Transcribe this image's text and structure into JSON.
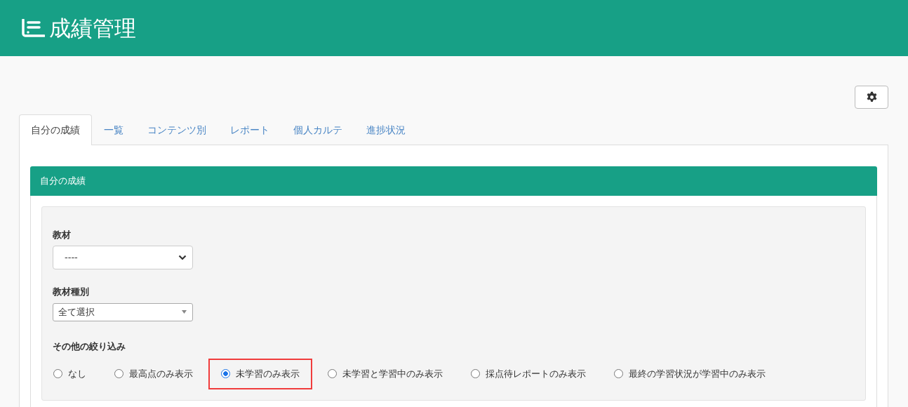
{
  "header": {
    "title": "成績管理"
  },
  "tabs": [
    {
      "label": "自分の成績",
      "selected": true
    },
    {
      "label": "一覧",
      "selected": false
    },
    {
      "label": "コンテンツ別",
      "selected": false
    },
    {
      "label": "レポート",
      "selected": false
    },
    {
      "label": "個人カルテ",
      "selected": false
    },
    {
      "label": "進捗状況",
      "selected": false
    }
  ],
  "panel": {
    "title": "自分の成績",
    "fields": [
      {
        "kind": "select",
        "label": "教材",
        "value": "----"
      },
      {
        "kind": "combo",
        "label": "教材種別",
        "value": "全て選択"
      }
    ],
    "filter": {
      "label": "その他の絞り込み",
      "options": [
        {
          "label": "なし",
          "selected": false,
          "highlighted": false
        },
        {
          "label": "最高点のみ表示",
          "selected": false,
          "highlighted": false
        },
        {
          "label": "未学習のみ表示",
          "selected": true,
          "highlighted": true
        },
        {
          "label": "未学習と学習中のみ表示",
          "selected": false,
          "highlighted": false
        },
        {
          "label": "採点待レポートのみ表示",
          "selected": false,
          "highlighted": false
        },
        {
          "label": "最終の学習状況が学習中のみ表示",
          "selected": false,
          "highlighted": false
        }
      ]
    }
  }
}
